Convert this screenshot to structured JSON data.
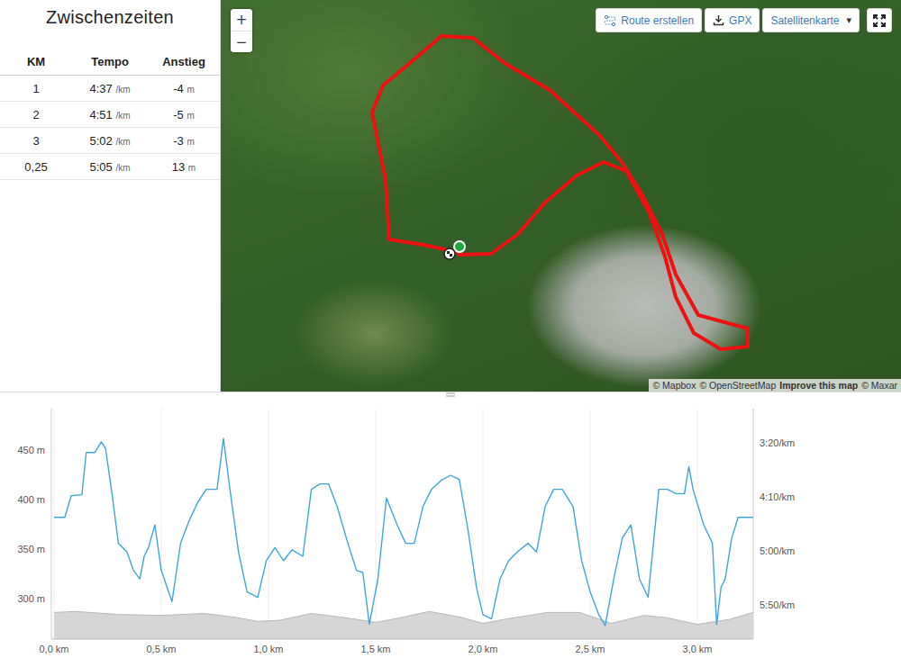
{
  "splits": {
    "title": "Zwischenzeiten",
    "columns": [
      "KM",
      "Tempo",
      "Anstieg"
    ],
    "rows": [
      {
        "km": "1",
        "pace": "4:37",
        "pace_unit": "/km",
        "ascent": "-4",
        "ascent_unit": "m"
      },
      {
        "km": "2",
        "pace": "4:51",
        "pace_unit": "/km",
        "ascent": "-5",
        "ascent_unit": "m"
      },
      {
        "km": "3",
        "pace": "5:02",
        "pace_unit": "/km",
        "ascent": "-3",
        "ascent_unit": "m"
      },
      {
        "km": "0,25",
        "pace": "5:05",
        "pace_unit": "/km",
        "ascent": "13",
        "ascent_unit": "m"
      }
    ]
  },
  "map": {
    "zoom_in": "+",
    "zoom_out": "−",
    "route_button": "Route erstellen",
    "gpx_button": "GPX",
    "layer_select": {
      "label": "Satellitenkarte",
      "caret": "▾"
    },
    "attribution": [
      {
        "text": "© Mapbox",
        "link": false
      },
      {
        "text": "© OpenStreetMap",
        "link": false
      },
      {
        "text": "Improve this map",
        "link": true
      },
      {
        "text": "© Maxar",
        "link": false
      }
    ],
    "route": [
      [
        263,
        280
      ],
      [
        225,
        272
      ],
      [
        187,
        266
      ],
      [
        183,
        200
      ],
      [
        168,
        125
      ],
      [
        180,
        95
      ],
      [
        210,
        70
      ],
      [
        245,
        40
      ],
      [
        280,
        42
      ],
      [
        315,
        70
      ],
      [
        365,
        100
      ],
      [
        420,
        150
      ],
      [
        445,
        180
      ],
      [
        467,
        215
      ],
      [
        490,
        260
      ],
      [
        505,
        305
      ],
      [
        530,
        350
      ],
      [
        585,
        365
      ],
      [
        585,
        385
      ],
      [
        555,
        388
      ],
      [
        525,
        370
      ],
      [
        505,
        330
      ],
      [
        493,
        285
      ],
      [
        475,
        235
      ],
      [
        450,
        190
      ],
      [
        425,
        180
      ],
      [
        395,
        195
      ],
      [
        360,
        225
      ],
      [
        330,
        260
      ],
      [
        300,
        282
      ],
      [
        263,
        283
      ]
    ],
    "markers": [
      {
        "kind": "start",
        "at": [
          265,
          274
        ],
        "color": "#1fa83a"
      },
      {
        "kind": "finish",
        "at": [
          254,
          282
        ],
        "color": "#222222"
      }
    ]
  },
  "chart": {
    "left_ticks": [
      {
        "value": 450,
        "label": "450 m"
      },
      {
        "value": 400,
        "label": "400 m"
      },
      {
        "value": 350,
        "label": "350 m"
      },
      {
        "value": 300,
        "label": "300 m"
      }
    ],
    "right_ticks": [
      {
        "value": 200,
        "label": "3:20/km"
      },
      {
        "value": 250,
        "label": "4:10/km"
      },
      {
        "value": 300,
        "label": "5:00/km"
      },
      {
        "value": 350,
        "label": "5:50/km"
      }
    ],
    "x_ticks": [
      {
        "value": 0,
        "label": "0,0 km"
      },
      {
        "value": 0.5,
        "label": "0,5 km"
      },
      {
        "value": 1,
        "label": "1,0 km"
      },
      {
        "value": 1.5,
        "label": "1,5 km"
      },
      {
        "value": 2,
        "label": "2,0 km"
      },
      {
        "value": 2.5,
        "label": "2,5 km"
      },
      {
        "value": 3,
        "label": "3,0 km"
      }
    ],
    "elevation": {
      "distance_km": [
        0,
        0.1,
        0.3,
        0.5,
        0.7,
        0.85,
        0.95,
        1.05,
        1.2,
        1.35,
        1.5,
        1.6,
        1.75,
        1.9,
        2.0,
        2.1,
        2.3,
        2.45,
        2.6,
        2.75,
        2.85,
        3.0,
        3.15,
        3.26
      ],
      "values_m": [
        286,
        287,
        284,
        283,
        285,
        281,
        277,
        278,
        285,
        281,
        276,
        280,
        287,
        281,
        275,
        279,
        286,
        286,
        275,
        283,
        281,
        274,
        279,
        286
      ]
    },
    "pace": {
      "distance_km": [
        0,
        0.05,
        0.08,
        0.13,
        0.15,
        0.19,
        0.22,
        0.24,
        0.27,
        0.3,
        0.34,
        0.37,
        0.4,
        0.42,
        0.44,
        0.47,
        0.5,
        0.55,
        0.59,
        0.63,
        0.67,
        0.71,
        0.76,
        0.79,
        0.82,
        0.86,
        0.9,
        0.95,
        0.99,
        1.03,
        1.07,
        1.11,
        1.16,
        1.2,
        1.24,
        1.28,
        1.32,
        1.37,
        1.41,
        1.44,
        1.47,
        1.51,
        1.55,
        1.6,
        1.64,
        1.68,
        1.72,
        1.76,
        1.81,
        1.85,
        1.89,
        1.93,
        1.97,
        2.0,
        2.04,
        2.08,
        2.12,
        2.16,
        2.21,
        2.25,
        2.29,
        2.33,
        2.37,
        2.42,
        2.46,
        2.5,
        2.54,
        2.57,
        2.61,
        2.65,
        2.69,
        2.73,
        2.77,
        2.82,
        2.86,
        2.9,
        2.94,
        2.96,
        2.98,
        3.03,
        3.07,
        3.09,
        3.11,
        3.13,
        3.16,
        3.19,
        3.26
      ],
      "values_s_per_km": [
        269,
        269,
        249,
        248,
        209,
        209,
        199,
        205,
        247,
        293,
        301,
        318,
        326,
        305,
        297,
        276,
        318,
        347,
        293,
        272,
        255,
        243,
        243,
        196,
        243,
        301,
        338,
        343,
        309,
        297,
        309,
        299,
        305,
        243,
        238,
        238,
        259,
        293,
        318,
        320,
        368,
        326,
        251,
        276,
        293,
        293,
        259,
        243,
        234,
        230,
        234,
        280,
        334,
        359,
        363,
        326,
        309,
        301,
        293,
        301,
        259,
        243,
        243,
        259,
        309,
        338,
        359,
        369,
        326,
        288,
        276,
        326,
        343,
        243,
        243,
        247,
        247,
        222,
        243,
        276,
        293,
        368,
        334,
        326,
        288,
        269,
        269
      ]
    }
  }
}
